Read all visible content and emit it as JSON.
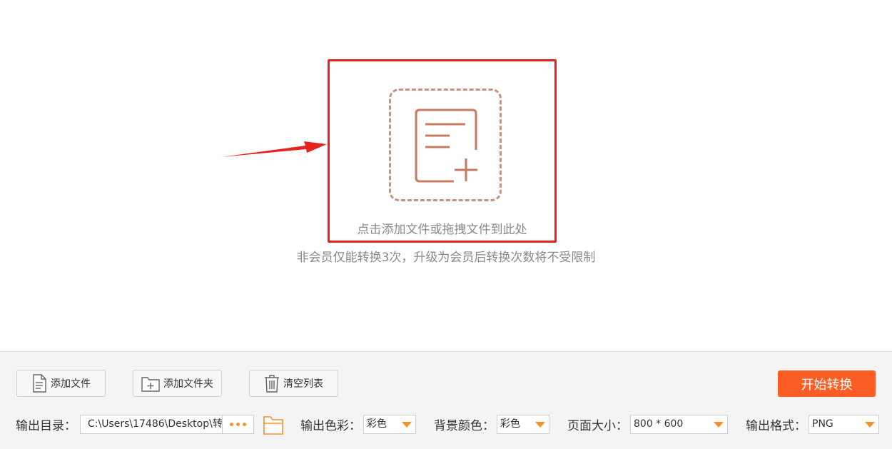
{
  "drop_zone": {
    "prompt": "点击添加文件或拖拽文件到此处",
    "limit_notice": "非会员仅能转换3次，升级为会员后转换次数将不受限制"
  },
  "toolbar": {
    "add_file": "添加文件",
    "add_folder": "添加文件夹",
    "clear_list": "清空列表",
    "start": "开始转换"
  },
  "settings": {
    "output_dir_label": "输出目录：",
    "output_dir_value": "C:\\Users\\17486\\Desktop\\转",
    "output_color_label": "输出色彩：",
    "output_color_value": "彩色",
    "bg_color_label": "背景颜色：",
    "bg_color_value": "彩色",
    "page_size_label": "页面大小：",
    "page_size_value": "800 * 600",
    "output_format_label": "输出格式：",
    "output_format_value": "PNG"
  },
  "colors": {
    "accent": "#fb5d24",
    "highlight": "#e8211d",
    "icon": "#c97a63",
    "dropdown_caret": "#f5922a"
  },
  "icons": [
    "arrow-pointer",
    "add-document-icon",
    "file-icon",
    "folder-plus-icon",
    "trash-icon",
    "more-dots-icon",
    "folder-icon",
    "caret-down-icon"
  ]
}
